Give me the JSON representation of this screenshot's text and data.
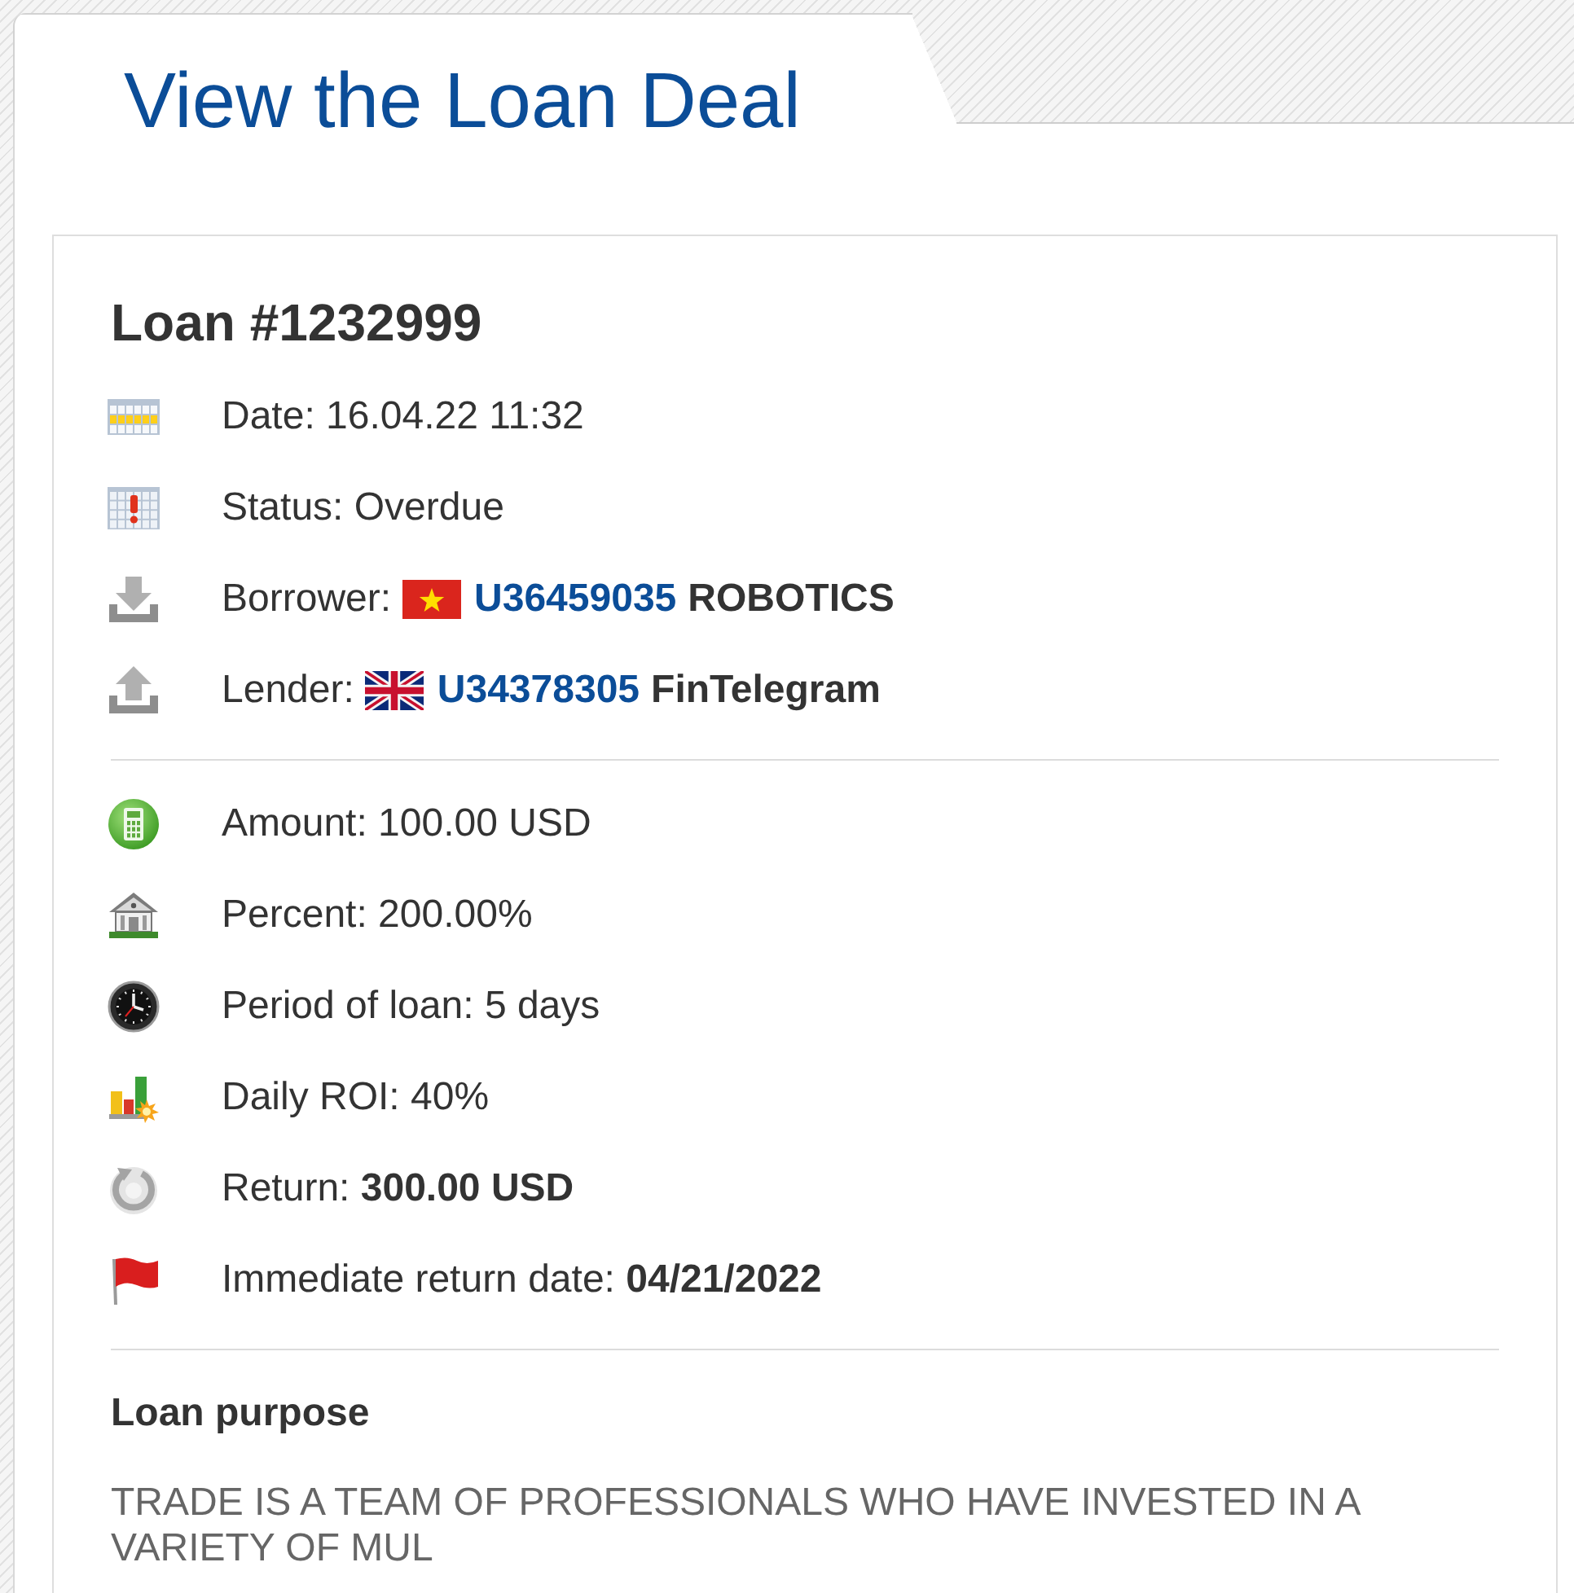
{
  "page_title": "View the Loan Deal",
  "loan": {
    "title": "Loan #1232999",
    "overview": [
      {
        "kind": "plain",
        "text": "Date: 16.04.22 11:32"
      },
      {
        "kind": "plain",
        "text": "Status: Overdue"
      },
      {
        "kind": "party",
        "label": "Borrower:",
        "account": "U36459035",
        "name": "ROBOTICS"
      },
      {
        "kind": "party",
        "label": "Lender:",
        "account": "U34378305",
        "name": "FinTelegram"
      }
    ],
    "terms": [
      {
        "kind": "plain",
        "text": "Amount: 100.00 USD"
      },
      {
        "kind": "plain",
        "text": "Percent: 200.00%"
      },
      {
        "kind": "plain",
        "text": "Period of loan: 5 days"
      },
      {
        "kind": "plain",
        "text": "Daily ROI: 40%"
      },
      {
        "kind": "plain",
        "text": "Return: **300.00 USD**"
      },
      {
        "kind": "plain",
        "text": "Immediate return date: **04/21/2022**"
      }
    ]
  },
  "purpose": {
    "heading": "Loan purpose",
    "text": "TRADE IS A TEAM OF PROFESSIONALS WHO HAVE INVESTED IN A VARIETY OF MUL"
  }
}
